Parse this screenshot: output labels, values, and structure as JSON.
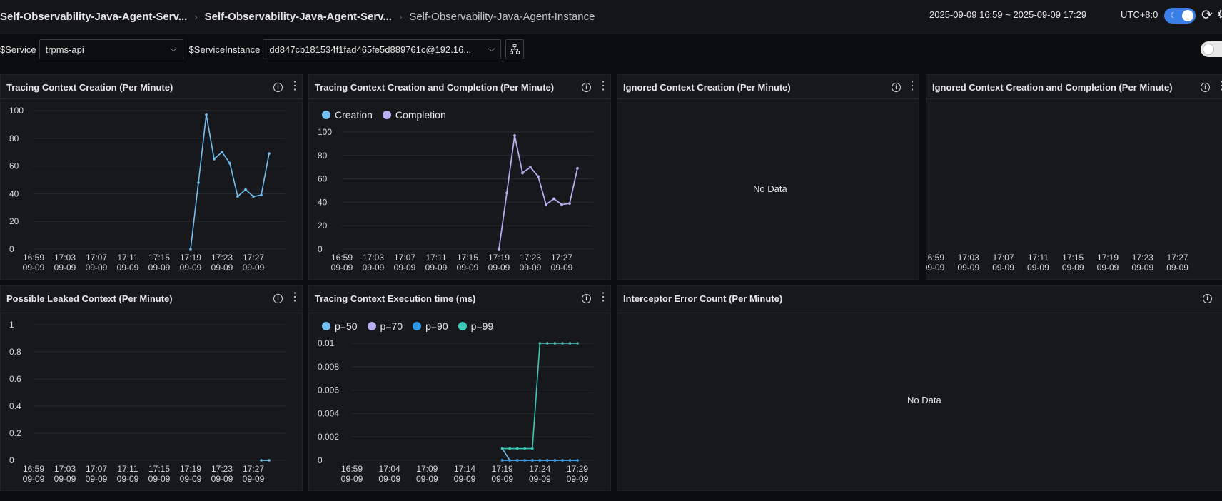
{
  "header": {
    "breadcrumb": [
      "Self-Observability-Java-Agent-Serv...",
      "Self-Observability-Java-Agent-Serv...",
      "Self-Observability-Java-Agent-Instance"
    ],
    "time_range": "2025-09-09 16:59 ~ 2025-09-09 17:29",
    "timezone": "UTC+8:0"
  },
  "variables": {
    "service_label": "$Service",
    "service_value": "trpms-api",
    "instance_label": "$ServiceInstance",
    "instance_value": "dd847cb181534f1fad465fe5d889761c@192.16..."
  },
  "colors": {
    "creation": "#73bff2",
    "completion": "#b7aef0",
    "p50": "#73bff2",
    "p70": "#b7aef0",
    "p90": "#2f9be8",
    "p99": "#3fc9bb"
  },
  "panels": {
    "p1": {
      "title": "Tracing Context Creation (Per Minute)"
    },
    "p2": {
      "title": "Tracing Context Creation and Completion (Per Minute)"
    },
    "p3": {
      "title": "Ignored Context Creation (Per Minute)",
      "no_data": "No Data"
    },
    "p4": {
      "title": "Ignored Context Creation and Completion (Per Minute)"
    },
    "p5": {
      "title": "Possible Leaked Context (Per Minute)"
    },
    "p6": {
      "title": "Tracing Context Execution time (ms)"
    },
    "p7": {
      "title": "Interceptor Error Count (Per Minute)",
      "no_data": "No Data"
    }
  },
  "chart_data": [
    {
      "id": "p1",
      "type": "line",
      "title": "Tracing Context Creation (Per Minute)",
      "ylim": [
        0,
        100
      ],
      "yticks": [
        "0",
        "20",
        "40",
        "60",
        "80",
        "100"
      ],
      "xticks": [
        "16:59",
        "17:03",
        "17:07",
        "17:11",
        "17:15",
        "17:19",
        "17:23",
        "17:27"
      ],
      "xticks_date": "09-09",
      "x_minutes": [
        "17:19",
        "17:20",
        "17:21",
        "17:22",
        "17:23",
        "17:24",
        "17:25",
        "17:26",
        "17:27",
        "17:28",
        "17:29"
      ],
      "series": [
        {
          "values": [
            0,
            48,
            97,
            65,
            70,
            62,
            38,
            43,
            38,
            39,
            69
          ]
        }
      ]
    },
    {
      "id": "p2",
      "type": "line",
      "title": "Tracing Context Creation and Completion (Per Minute)",
      "ylim": [
        0,
        100
      ],
      "yticks": [
        "0",
        "20",
        "40",
        "60",
        "80",
        "100"
      ],
      "xticks": [
        "16:59",
        "17:03",
        "17:07",
        "17:11",
        "17:15",
        "17:19",
        "17:23",
        "17:27"
      ],
      "xticks_date": "09-09",
      "x_minutes": [
        "17:19",
        "17:20",
        "17:21",
        "17:22",
        "17:23",
        "17:24",
        "17:25",
        "17:26",
        "17:27",
        "17:28",
        "17:29"
      ],
      "series": [
        {
          "name": "Creation",
          "values": [
            0,
            48,
            97,
            65,
            70,
            62,
            38,
            43,
            38,
            39,
            69
          ]
        },
        {
          "name": "Completion",
          "values": [
            0,
            48,
            97,
            65,
            70,
            62,
            38,
            43,
            38,
            39,
            69
          ]
        }
      ]
    },
    {
      "id": "p4",
      "type": "line",
      "title": "Ignored Context Creation and Completion (Per Minute)",
      "xticks": [
        "16:59",
        "17:03",
        "17:07",
        "17:11",
        "17:15",
        "17:19",
        "17:23",
        "17:27"
      ],
      "xticks_date": "09-09",
      "series": []
    },
    {
      "id": "p5",
      "type": "line",
      "title": "Possible Leaked Context (Per Minute)",
      "ylim": [
        0,
        1
      ],
      "yticks": [
        "0",
        "0.2",
        "0.4",
        "0.6",
        "0.8",
        "1"
      ],
      "xticks": [
        "16:59",
        "17:03",
        "17:07",
        "17:11",
        "17:15",
        "17:19",
        "17:23",
        "17:27"
      ],
      "xticks_date": "09-09",
      "x_minutes": [
        "17:28",
        "17:29"
      ],
      "series": [
        {
          "values": [
            0,
            0
          ]
        }
      ]
    },
    {
      "id": "p6",
      "type": "line",
      "title": "Tracing Context Execution time (ms)",
      "ylim": [
        0,
        0.01
      ],
      "yticks": [
        "0",
        "0.002",
        "0.004",
        "0.006",
        "0.008",
        "0.01"
      ],
      "xticks": [
        "16:59",
        "17:04",
        "17:09",
        "17:14",
        "17:19",
        "17:24",
        "17:29"
      ],
      "xticks_date": "09-09",
      "x_minutes": [
        "17:19",
        "17:20",
        "17:21",
        "17:22",
        "17:23",
        "17:24",
        "17:25",
        "17:26",
        "17:27",
        "17:28",
        "17:29"
      ],
      "series": [
        {
          "name": "p=50",
          "values": [
            0.001,
            0,
            0,
            0,
            0,
            0,
            0,
            0,
            0,
            0,
            0
          ]
        },
        {
          "name": "p=70",
          "values": [
            0,
            0,
            0,
            0,
            0,
            0,
            0,
            0,
            0,
            0,
            0
          ]
        },
        {
          "name": "p=90",
          "values": [
            0,
            0,
            0,
            0,
            0,
            0,
            0,
            0,
            0,
            0,
            0
          ]
        },
        {
          "name": "p=99",
          "values": [
            0.001,
            0.001,
            0.001,
            0.001,
            0.001,
            0.01,
            0.01,
            0.01,
            0.01,
            0.01,
            0.01
          ]
        }
      ]
    }
  ]
}
